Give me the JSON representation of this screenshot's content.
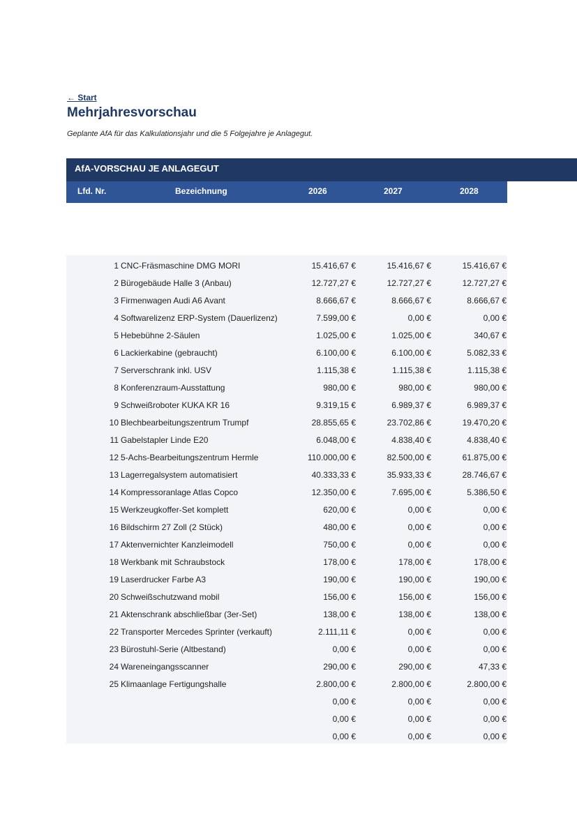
{
  "nav": {
    "back_label": "← Start"
  },
  "page": {
    "title": "Mehrjahresvorschau",
    "subtitle": "Geplante AfA für das Kalkulationsjahr und die 5 Folgejahre je Anlagegut."
  },
  "section": {
    "title": "AfA-VORSCHAU JE ANLAGEGUT"
  },
  "table": {
    "headers": [
      "Lfd. Nr.",
      "Bezeichnung",
      "2026",
      "2027",
      "2028"
    ],
    "rows": [
      {
        "nr": "1",
        "bez": "CNC-Fräsmaschine DMG MORI",
        "y0": "15.416,67 €",
        "y1": "15.416,67 €",
        "y2": "15.416,67 €"
      },
      {
        "nr": "2",
        "bez": "Bürogebäude Halle 3 (Anbau)",
        "y0": "12.727,27 €",
        "y1": "12.727,27 €",
        "y2": "12.727,27 €"
      },
      {
        "nr": "3",
        "bez": "Firmenwagen Audi A6 Avant",
        "y0": "8.666,67 €",
        "y1": "8.666,67 €",
        "y2": "8.666,67 €"
      },
      {
        "nr": "4",
        "bez": "Softwarelizenz ERP-System (Dauerlizenz)",
        "y0": "7.599,00 €",
        "y1": "0,00 €",
        "y2": "0,00 €"
      },
      {
        "nr": "5",
        "bez": "Hebebühne 2-Säulen",
        "y0": "1.025,00 €",
        "y1": "1.025,00 €",
        "y2": "340,67 €"
      },
      {
        "nr": "6",
        "bez": "Lackierkabine (gebraucht)",
        "y0": "6.100,00 €",
        "y1": "6.100,00 €",
        "y2": "5.082,33 €"
      },
      {
        "nr": "7",
        "bez": "Serverschrank inkl. USV",
        "y0": "1.115,38 €",
        "y1": "1.115,38 €",
        "y2": "1.115,38 €"
      },
      {
        "nr": "8",
        "bez": "Konferenzraum-Ausstattung",
        "y0": "980,00 €",
        "y1": "980,00 €",
        "y2": "980,00 €"
      },
      {
        "nr": "9",
        "bez": "Schweißroboter KUKA KR 16",
        "y0": "9.319,15 €",
        "y1": "6.989,37 €",
        "y2": "6.989,37 €"
      },
      {
        "nr": "10",
        "bez": "Blechbearbeitungszentrum Trumpf",
        "y0": "28.855,65 €",
        "y1": "23.702,86 €",
        "y2": "19.470,20 €"
      },
      {
        "nr": "11",
        "bez": "Gabelstapler Linde E20",
        "y0": "6.048,00 €",
        "y1": "4.838,40 €",
        "y2": "4.838,40 €"
      },
      {
        "nr": "12",
        "bez": "5-Achs-Bearbeitungszentrum Hermle",
        "y0": "110.000,00 €",
        "y1": "82.500,00 €",
        "y2": "61.875,00 €"
      },
      {
        "nr": "13",
        "bez": "Lagerregalsystem automatisiert",
        "y0": "40.333,33 €",
        "y1": "35.933,33 €",
        "y2": "28.746,67 €"
      },
      {
        "nr": "14",
        "bez": "Kompressoranlage Atlas Copco",
        "y0": "12.350,00 €",
        "y1": "7.695,00 €",
        "y2": "5.386,50 €"
      },
      {
        "nr": "15",
        "bez": "Werkzeugkoffer-Set komplett",
        "y0": "620,00 €",
        "y1": "0,00 €",
        "y2": "0,00 €"
      },
      {
        "nr": "16",
        "bez": "Bildschirm 27 Zoll (2 Stück)",
        "y0": "480,00 €",
        "y1": "0,00 €",
        "y2": "0,00 €"
      },
      {
        "nr": "17",
        "bez": "Aktenvernichter Kanzleimodell",
        "y0": "750,00 €",
        "y1": "0,00 €",
        "y2": "0,00 €"
      },
      {
        "nr": "18",
        "bez": "Werkbank mit Schraubstock",
        "y0": "178,00 €",
        "y1": "178,00 €",
        "y2": "178,00 €"
      },
      {
        "nr": "19",
        "bez": "Laserdrucker Farbe A3",
        "y0": "190,00 €",
        "y1": "190,00 €",
        "y2": "190,00 €"
      },
      {
        "nr": "20",
        "bez": "Schweißschutzwand mobil",
        "y0": "156,00 €",
        "y1": "156,00 €",
        "y2": "156,00 €"
      },
      {
        "nr": "21",
        "bez": "Aktenschrank abschließbar (3er-Set)",
        "y0": "138,00 €",
        "y1": "138,00 €",
        "y2": "138,00 €"
      },
      {
        "nr": "22",
        "bez": "Transporter Mercedes Sprinter (verkauft)",
        "y0": "2.111,11 €",
        "y1": "0,00 €",
        "y2": "0,00 €"
      },
      {
        "nr": "23",
        "bez": "Bürostuhl-Serie (Altbestand)",
        "y0": "0,00 €",
        "y1": "0,00 €",
        "y2": "0,00 €"
      },
      {
        "nr": "24",
        "bez": "Wareneingangsscanner",
        "y0": "290,00 €",
        "y1": "290,00 €",
        "y2": "47,33 €"
      },
      {
        "nr": "25",
        "bez": "Klimaanlage Fertigungshalle",
        "y0": "2.800,00 €",
        "y1": "2.800,00 €",
        "y2": "2.800,00 €"
      },
      {
        "nr": "",
        "bez": "",
        "y0": "0,00 €",
        "y1": "0,00 €",
        "y2": "0,00 €"
      },
      {
        "nr": "",
        "bez": "",
        "y0": "0,00 €",
        "y1": "0,00 €",
        "y2": "0,00 €"
      },
      {
        "nr": "",
        "bez": "",
        "y0": "0,00 €",
        "y1": "0,00 €",
        "y2": "0,00 €"
      }
    ]
  }
}
